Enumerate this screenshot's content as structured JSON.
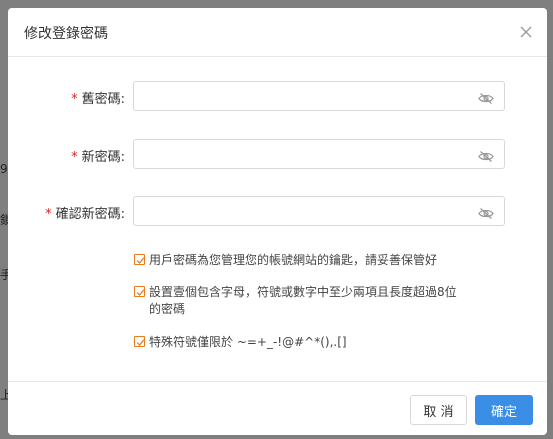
{
  "backdrop": {
    "fragments": [
      "9",
      "鎖",
      "手",
      "上"
    ]
  },
  "dialog": {
    "title": "修改登錄密碼",
    "close_icon": "close-icon"
  },
  "form": {
    "required_mark": "*",
    "old_password": {
      "label": "舊密碼:",
      "value": ""
    },
    "new_password": {
      "label": "新密碼:",
      "value": ""
    },
    "confirm_password": {
      "label": "確認新密碼:",
      "value": ""
    },
    "toggle_icon": "eye-slash-icon"
  },
  "hints": [
    "用戶密碼為您管理您的帳號網站的鑰匙，請妥善保管好",
    "設置壹個包含字母，符號或數字中至少兩項且長度超過8位的密碼",
    "特殊符號僅限於 ~=+_-!@#^*(),.[]"
  ],
  "footer": {
    "cancel_label": "取 消",
    "ok_label": "確定"
  },
  "colors": {
    "primary": "#3a8ee6",
    "required": "#e02020",
    "check_accent": "#e87d1f"
  }
}
